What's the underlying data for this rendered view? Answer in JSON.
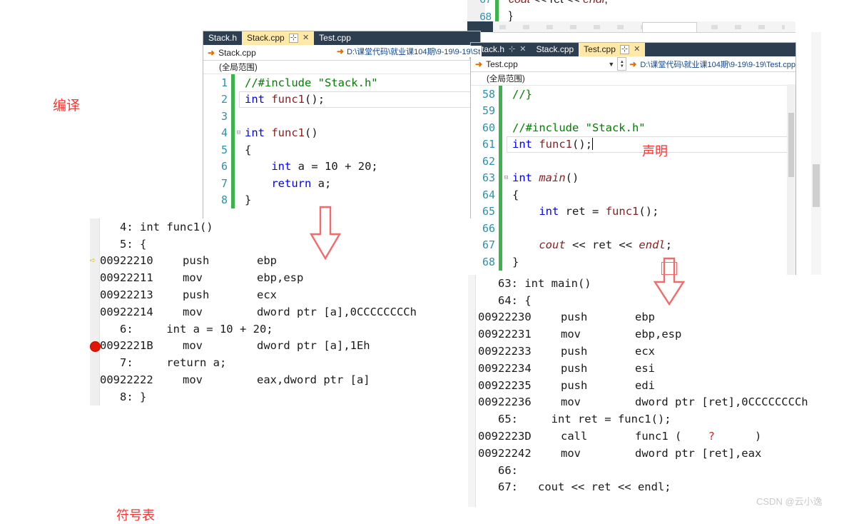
{
  "annotations": {
    "compile_label": "编译",
    "declare_label": "声明",
    "bottom_label": "符号表",
    "watermark": "CSDN @云小逸"
  },
  "top_fragment": {
    "lines": [
      {
        "num": "67",
        "text": "cout << ret << endl;"
      },
      {
        "num": "68",
        "text": "}"
      }
    ]
  },
  "left_window": {
    "tabs": [
      {
        "label": "Stack.h",
        "active": false,
        "pin": "",
        "close": ""
      },
      {
        "label": "Stack.cpp",
        "active": true,
        "pin": "⊹",
        "close": "✕"
      },
      {
        "label": "Test.cpp",
        "active": false,
        "pin": "",
        "close": ""
      }
    ],
    "nav_file": "Stack.cpp",
    "path": "D:\\课堂代码\\就业课104期\\9-19\\9-19\\St",
    "scope": "(全局范围)",
    "code_lines": [
      {
        "num": "1",
        "text": "//#include \"Stack.h\""
      },
      {
        "num": "2",
        "text": "int func1();"
      },
      {
        "num": "3",
        "text": ""
      },
      {
        "num": "4",
        "text": "int func1()"
      },
      {
        "num": "5",
        "text": "{"
      },
      {
        "num": "6",
        "text": "    int a = 10 + 20;"
      },
      {
        "num": "7",
        "text": "    return a;"
      },
      {
        "num": "8",
        "text": "}"
      }
    ]
  },
  "right_window": {
    "tabs": [
      {
        "label": "Stack.h",
        "active": false,
        "pin": "⊹",
        "close": "✕"
      },
      {
        "label": "Stack.cpp",
        "active": false,
        "pin": "",
        "close": ""
      },
      {
        "label": "Test.cpp",
        "active": true,
        "pin": "⊹",
        "close": "✕"
      }
    ],
    "nav_file": "Test.cpp",
    "path": "D:\\课堂代码\\就业课104期\\9-19\\9-19\\Test.cpp",
    "scope": "(全局范围)",
    "code_lines": [
      {
        "num": "58",
        "text": "//}"
      },
      {
        "num": "59",
        "text": ""
      },
      {
        "num": "60",
        "text": "//#include \"Stack.h\""
      },
      {
        "num": "61",
        "text": "int func1();"
      },
      {
        "num": "62",
        "text": ""
      },
      {
        "num": "63",
        "text": "int main()"
      },
      {
        "num": "64",
        "text": "{"
      },
      {
        "num": "65",
        "text": "    int ret = func1();"
      },
      {
        "num": "66",
        "text": ""
      },
      {
        "num": "67",
        "text": "    cout << ret << endl;"
      },
      {
        "num": "68",
        "text": "}"
      }
    ]
  },
  "left_disasm": {
    "rows": [
      {
        "kind": "src",
        "num": "4:",
        "src": "int func1()",
        "marker": ""
      },
      {
        "kind": "src",
        "num": "5:",
        "src": "{",
        "marker": ""
      },
      {
        "kind": "asm",
        "addr": "00922210",
        "op": "push",
        "args": "ebp",
        "marker": "ip"
      },
      {
        "kind": "asm",
        "addr": "00922211",
        "op": "mov",
        "args": "ebp,esp",
        "marker": ""
      },
      {
        "kind": "asm",
        "addr": "00922213",
        "op": "push",
        "args": "ecx",
        "marker": ""
      },
      {
        "kind": "asm",
        "addr": "00922214",
        "op": "mov",
        "args": "dword ptr [a],0CCCCCCCCh",
        "marker": ""
      },
      {
        "kind": "src",
        "num": "6:",
        "src": "    int a = 10 + 20;",
        "marker": ""
      },
      {
        "kind": "asm",
        "addr": "0092221B",
        "op": "mov",
        "args": "dword ptr [a],1Eh",
        "marker": "bp"
      },
      {
        "kind": "src",
        "num": "7:",
        "src": "    return a;",
        "marker": ""
      },
      {
        "kind": "asm",
        "addr": "00922222",
        "op": "mov",
        "args": "eax,dword ptr [a]",
        "marker": ""
      },
      {
        "kind": "src",
        "num": "8:",
        "src": "}",
        "marker": ""
      }
    ]
  },
  "right_disasm": {
    "rows": [
      {
        "kind": "src",
        "num": "63:",
        "src": "int main()",
        "marker": ""
      },
      {
        "kind": "src",
        "num": "64:",
        "src": "{",
        "marker": ""
      },
      {
        "kind": "asm",
        "addr": "00922230",
        "op": "push",
        "args": "ebp",
        "marker": ""
      },
      {
        "kind": "asm",
        "addr": "00922231",
        "op": "mov",
        "args": "ebp,esp",
        "marker": ""
      },
      {
        "kind": "asm",
        "addr": "00922233",
        "op": "push",
        "args": "ecx",
        "marker": ""
      },
      {
        "kind": "asm",
        "addr": "00922234",
        "op": "push",
        "args": "esi",
        "marker": ""
      },
      {
        "kind": "asm",
        "addr": "00922235",
        "op": "push",
        "args": "edi",
        "marker": ""
      },
      {
        "kind": "asm",
        "addr": "00922236",
        "op": "mov",
        "args": "dword ptr [ret],0CCCCCCCCh",
        "marker": ""
      },
      {
        "kind": "src",
        "num": "65:",
        "src": "    int ret = func1();",
        "marker": ""
      },
      {
        "kind": "asm",
        "addr": "0092223D",
        "op": "call",
        "args": "func1 (    ?      )",
        "marker": ""
      },
      {
        "kind": "asm",
        "addr": "00922242",
        "op": "mov",
        "args": "dword ptr [ret],eax",
        "marker": ""
      },
      {
        "kind": "src",
        "num": "66:",
        "src": "",
        "marker": ""
      },
      {
        "kind": "src",
        "num": "67:",
        "src": "  cout << ret << endl;",
        "marker": ""
      }
    ]
  },
  "colors": {
    "tab_bar": "#2d3e50",
    "tab_active": "#ffe9a8",
    "gutter_green": "#3cb44b",
    "annotation_red": "#ff3333",
    "breakpoint_red": "#e51400",
    "line_number": "#2b91af"
  }
}
